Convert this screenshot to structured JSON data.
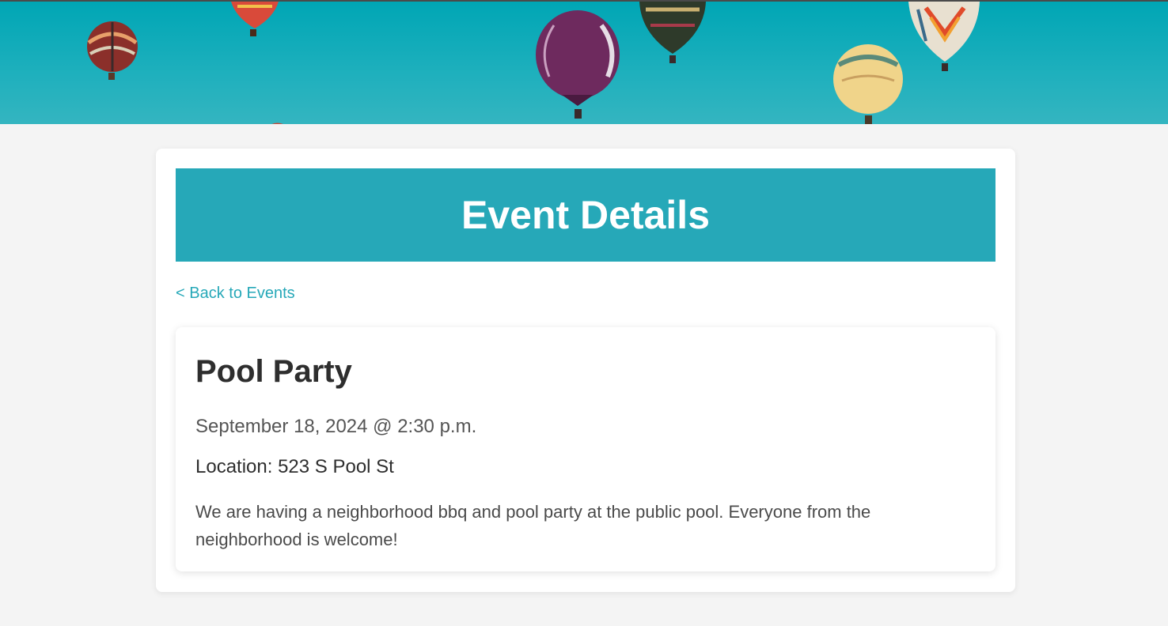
{
  "page": {
    "title": "Event Details",
    "back_link": "< Back to Events"
  },
  "event": {
    "name": "Pool Party",
    "datetime": "September 18, 2024 @ 2:30 p.m.",
    "location": "Location: 523 S Pool St",
    "description": "We are having a neighborhood bbq and pool party at the public pool. Everyone from the neighborhood is welcome!"
  },
  "colors": {
    "accent": "#26a8b8",
    "sky": "#00a6b5",
    "background": "#f4f4f4",
    "card": "#ffffff",
    "heading_text": "#2e2e2e"
  },
  "hero": {
    "image": "hot-air-balloons-banner"
  }
}
